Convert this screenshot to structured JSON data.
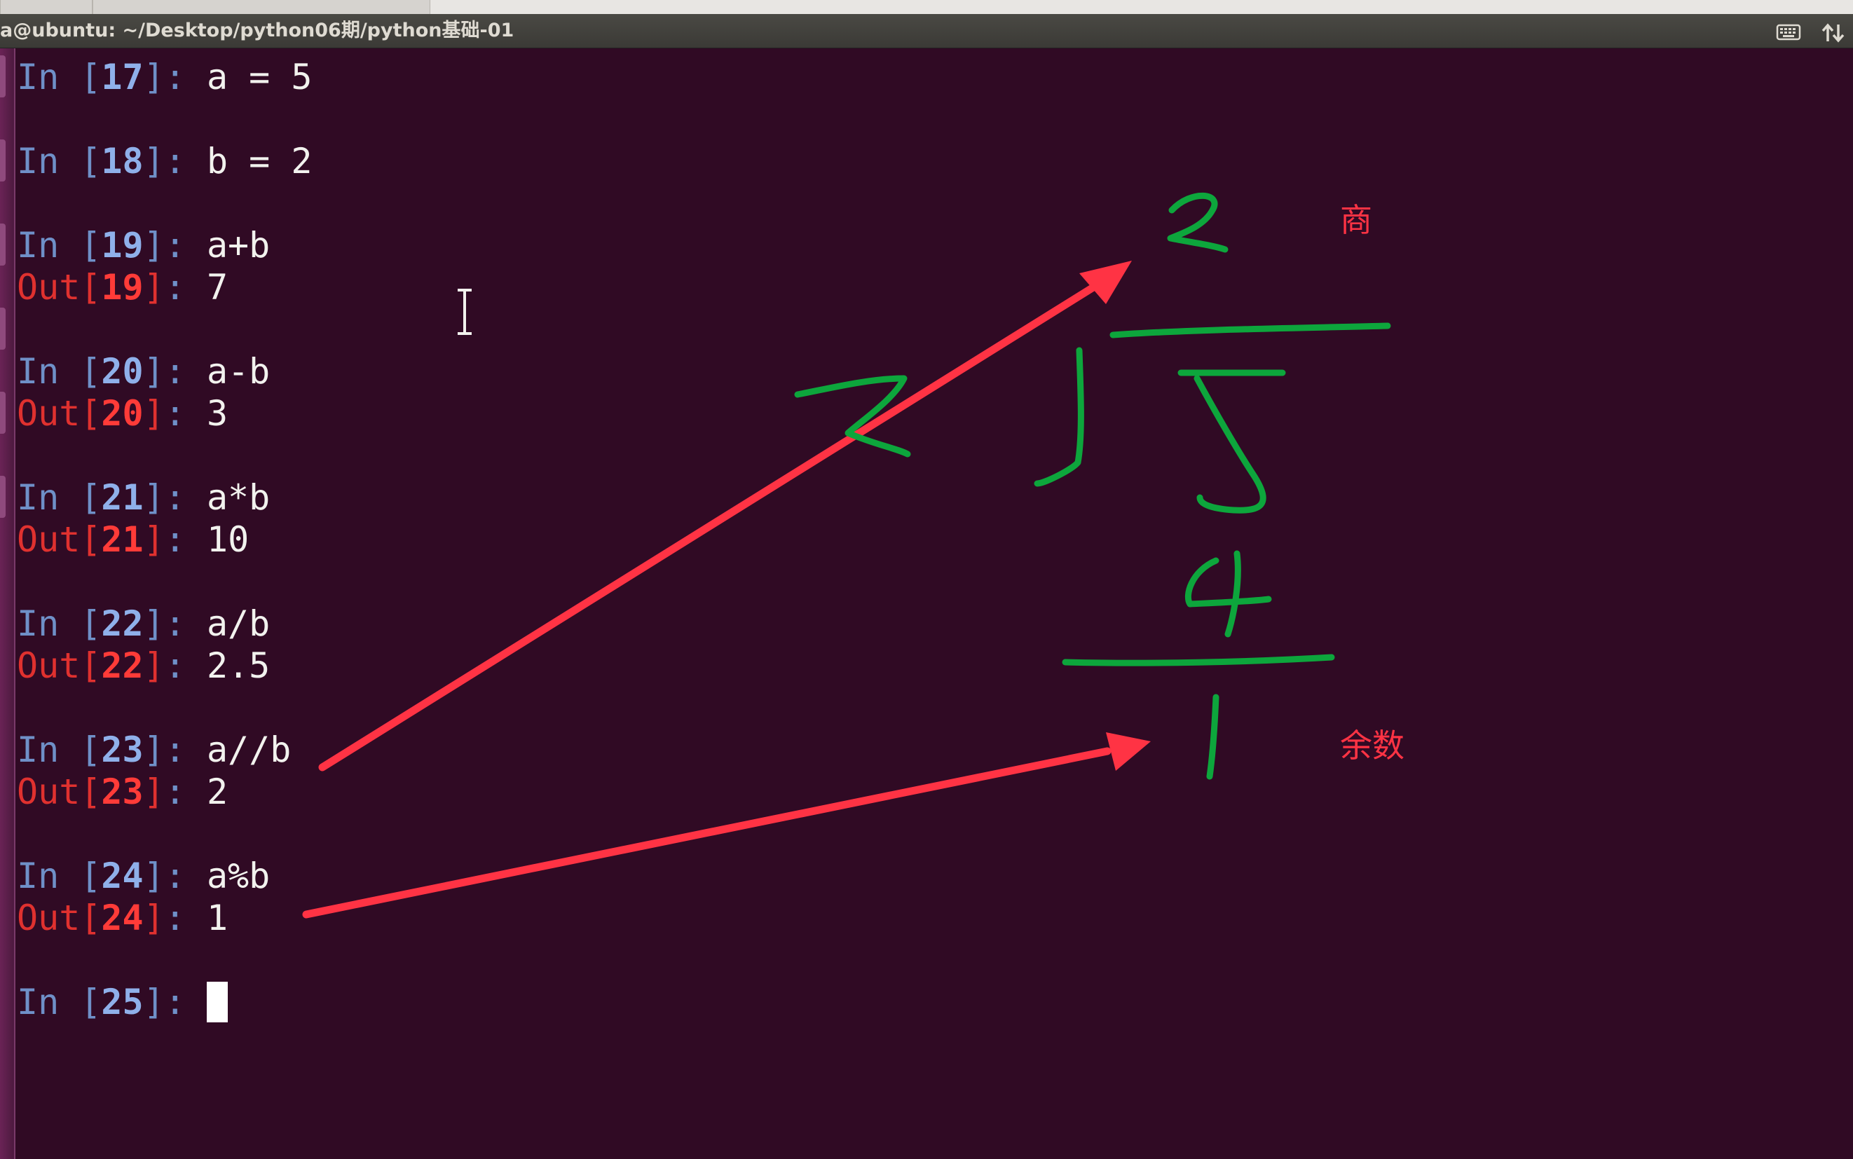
{
  "window": {
    "title": "a@ubuntu: ~/Desktop/python06期/python基础-01",
    "tray_icons": [
      "keyboard-icon",
      "network-arrows-icon"
    ]
  },
  "session": {
    "cells": [
      {
        "in_label": "In ",
        "in_num": "17",
        "code": "a = 5"
      },
      {
        "in_label": "In ",
        "in_num": "18",
        "code": "b = 2"
      },
      {
        "in_label": "In ",
        "in_num": "19",
        "code": "a+b",
        "out_label": "Out",
        "out_num": "19",
        "output": "7"
      },
      {
        "in_label": "In ",
        "in_num": "20",
        "code": "a-b",
        "out_label": "Out",
        "out_num": "20",
        "output": "3"
      },
      {
        "in_label": "In ",
        "in_num": "21",
        "code": "a*b",
        "out_label": "Out",
        "out_num": "21",
        "output": "10"
      },
      {
        "in_label": "In ",
        "in_num": "22",
        "code": "a/b",
        "out_label": "Out",
        "out_num": "22",
        "output": "2.5"
      },
      {
        "in_label": "In ",
        "in_num": "23",
        "code": "a//b",
        "out_label": "Out",
        "out_num": "23",
        "output": "2"
      },
      {
        "in_label": "In ",
        "in_num": "24",
        "code": "a%b",
        "out_label": "Out",
        "out_num": "24",
        "output": "1"
      }
    ],
    "prompt": {
      "in_label": "In ",
      "in_num": "25"
    }
  },
  "annotations": {
    "quotient_label": "商",
    "remainder_label": "余数",
    "handwriting": {
      "quotient_digit": "2",
      "divisor_digit": "2",
      "dividend_digits": "5",
      "product_digit": "4",
      "remainder_digit": "1"
    },
    "colors": {
      "arrow": "#ff3344",
      "handwriting": "#0da63c",
      "label": "#ff3344"
    }
  }
}
